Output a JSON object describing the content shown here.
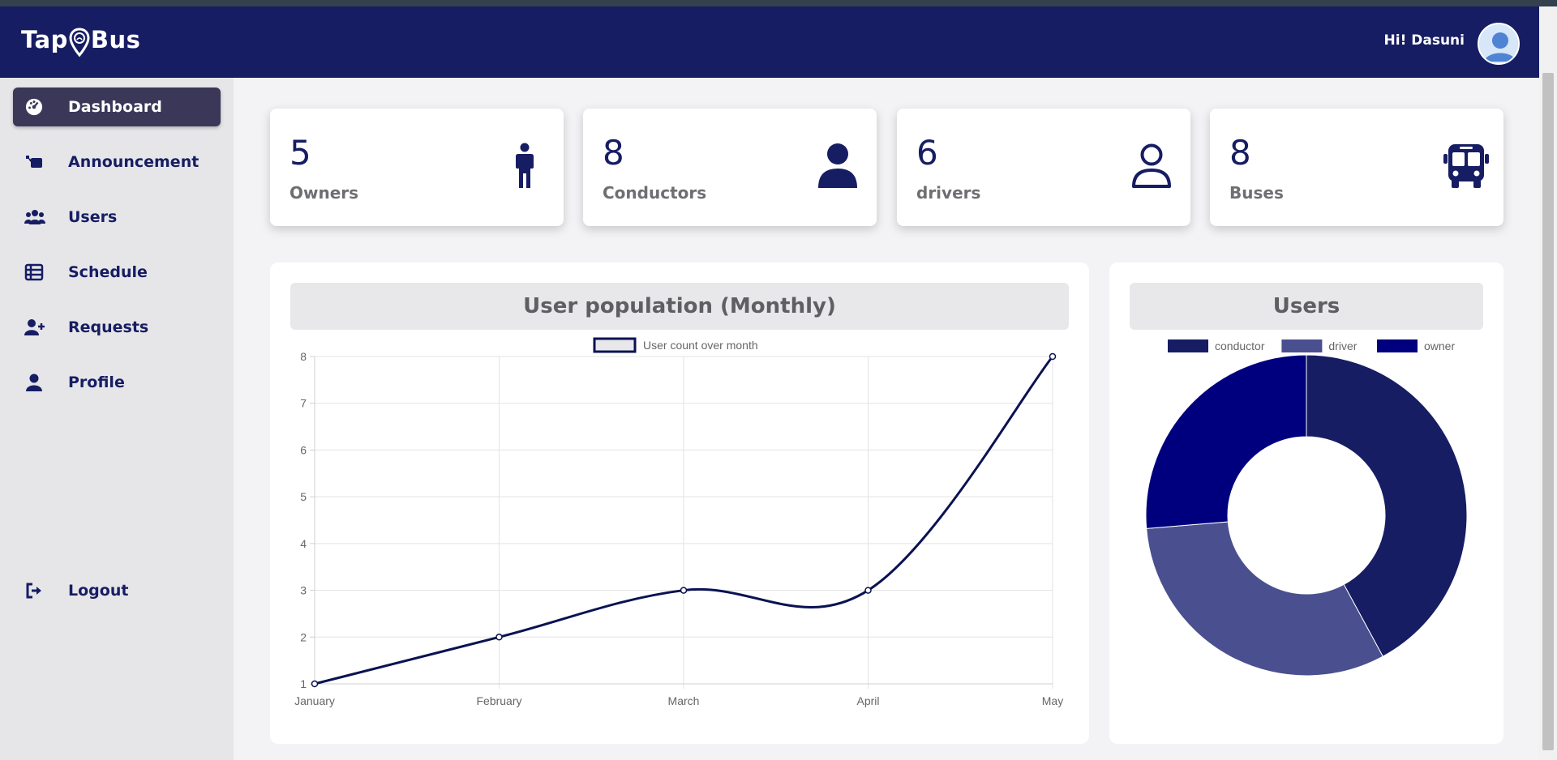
{
  "header": {
    "logo_text_left": "Tap",
    "logo_text_right": "Bus",
    "greeting": "Hi! Dasuni",
    "brand_color": "#161d63"
  },
  "sidebar": {
    "items": [
      {
        "label": "Dashboard",
        "icon": "gauge-icon",
        "active": true
      },
      {
        "label": "Announcement",
        "icon": "announcement-icon"
      },
      {
        "label": "Users",
        "icon": "users-icon"
      },
      {
        "label": "Schedule",
        "icon": "table-icon"
      },
      {
        "label": "Requests",
        "icon": "user-plus-icon"
      },
      {
        "label": "Profile",
        "icon": "user-icon"
      }
    ],
    "logout": {
      "label": "Logout",
      "icon": "logout-icon"
    }
  },
  "stats": [
    {
      "value": "5",
      "label": "Owners",
      "icon": "person-standing-icon"
    },
    {
      "value": "8",
      "label": "Conductors",
      "icon": "user-solid-icon"
    },
    {
      "value": "6",
      "label": "drivers",
      "icon": "user-outline-icon"
    },
    {
      "value": "8",
      "label": "Buses",
      "icon": "bus-icon"
    }
  ],
  "line_panel": {
    "title": "User population (Monthly)"
  },
  "pie_panel": {
    "title": "Users"
  },
  "chart_data": [
    {
      "type": "line",
      "categories": [
        "January",
        "February",
        "March",
        "April",
        "May"
      ],
      "series": [
        {
          "name": "User count over month",
          "values": [
            1,
            2,
            3,
            3,
            8
          ],
          "color": "#0a1252"
        }
      ],
      "ylim": [
        1,
        8
      ],
      "yticks": [
        "1",
        "2",
        "3",
        "4",
        "5",
        "6",
        "7",
        "8"
      ],
      "grid": true,
      "legend": "top"
    },
    {
      "type": "pie",
      "donut": true,
      "labels": [
        "conductor",
        "driver",
        "owner"
      ],
      "values": [
        8,
        6,
        5
      ],
      "colors": [
        "#161d63",
        "#4a4f8f",
        "#00007e"
      ],
      "legend": "top"
    }
  ]
}
